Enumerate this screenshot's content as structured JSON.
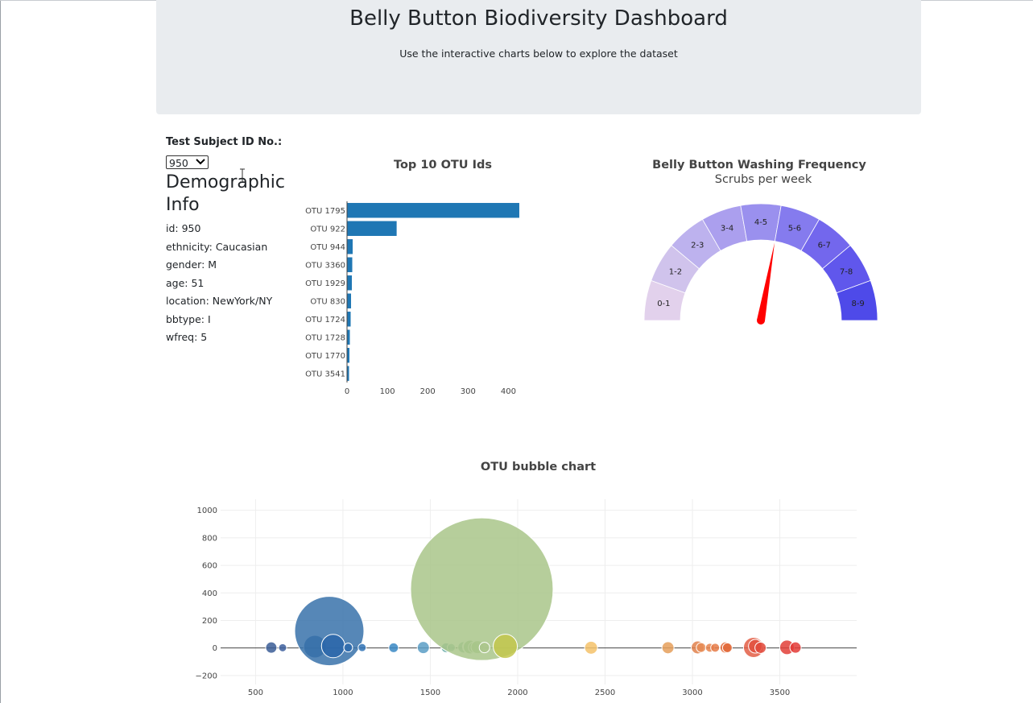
{
  "header": {
    "title": "Belly Button Biodiversity Dashboard",
    "subtitle": "Use the interactive charts below to explore the dataset"
  },
  "selector": {
    "label": "Test Subject ID No.:",
    "selected": "950"
  },
  "demographics": {
    "title": "Demographic Info",
    "items": [
      "id: 950",
      "ethnicity: Caucasian",
      "gender: M",
      "age: 51",
      "location: NewYork/NY",
      "bbtype: I",
      "wfreq: 5"
    ]
  },
  "colors": {
    "bar": "#1f77b4",
    "needle": "#ff0000",
    "jumbotron": "#e9ecef"
  },
  "chart_data": [
    {
      "type": "bar",
      "orientation": "horizontal",
      "title": "Top 10 OTU Ids",
      "categories": [
        "OTU 1795",
        "OTU 922",
        "OTU 944",
        "OTU 3360",
        "OTU 1929",
        "OTU 830",
        "OTU 1724",
        "OTU 1728",
        "OTU 1770",
        "OTU 3541"
      ],
      "values": [
        427,
        123,
        14,
        13,
        12,
        10,
        9,
        7,
        6,
        5
      ],
      "xticks": [
        0,
        100,
        200,
        300,
        400
      ],
      "xlim": [
        0,
        449
      ]
    },
    {
      "type": "gauge",
      "title": "Belly Button Washing Frequency",
      "subtitle": "Scrubs per week",
      "segments": [
        "0-1",
        "1-2",
        "2-3",
        "3-4",
        "4-5",
        "5-6",
        "6-7",
        "7-8",
        "8-9"
      ],
      "segment_colors": [
        "#e2d1ec",
        "#d0c3ec",
        "#bdb2ee",
        "#ab9fee",
        "#9a90ee",
        "#857bee",
        "#7367ed",
        "#6057ec",
        "#4e4ae9"
      ],
      "value": 5,
      "range": [
        0,
        9
      ]
    },
    {
      "type": "scatter",
      "title": "OTU bubble chart",
      "xticks": [
        500,
        1000,
        1500,
        2000,
        2500,
        3000,
        3500
      ],
      "yticks": [
        -200,
        0,
        200,
        400,
        600,
        800,
        1000
      ],
      "xlim": [
        300,
        3940
      ],
      "ylim": [
        -265,
        1080
      ],
      "points": [
        {
          "x": 590,
          "y": 3,
          "size": 14,
          "color": "#3b5d97"
        },
        {
          "x": 655,
          "y": 2,
          "size": 10,
          "color": "#3d5f9d"
        },
        {
          "x": 840,
          "y": 10,
          "size": 28,
          "color": "#2b61a2"
        },
        {
          "x": 922,
          "y": 123,
          "size": 86,
          "color": "#3872aa"
        },
        {
          "x": 944,
          "y": 14,
          "size": 29,
          "color": "#2a66aa"
        },
        {
          "x": 1030,
          "y": 3,
          "size": 11,
          "color": "#2d6aad"
        },
        {
          "x": 1110,
          "y": 3,
          "size": 10,
          "color": "#2f72b5"
        },
        {
          "x": 1290,
          "y": 2,
          "size": 12,
          "color": "#3a88c4"
        },
        {
          "x": 1460,
          "y": 3,
          "size": 15,
          "color": "#5a9ec6"
        },
        {
          "x": 1590,
          "y": 2,
          "size": 12,
          "color": "#63a8a5"
        },
        {
          "x": 1620,
          "y": 3,
          "size": 10,
          "color": "#77b5a3"
        },
        {
          "x": 1690,
          "y": 5,
          "size": 14,
          "color": "#84b89a"
        },
        {
          "x": 1724,
          "y": 9,
          "size": 17,
          "color": "#8ebd95"
        },
        {
          "x": 1728,
          "y": 7,
          "size": 17,
          "color": "#97c092"
        },
        {
          "x": 1750,
          "y": 4,
          "size": 14,
          "color": "#98c195"
        },
        {
          "x": 1770,
          "y": 6,
          "size": 16,
          "color": "#a3c68f"
        },
        {
          "x": 1795,
          "y": 427,
          "size": 177,
          "color": "#a9c68a"
        },
        {
          "x": 1810,
          "y": 3,
          "size": 13,
          "color": "#acc68c"
        },
        {
          "x": 1929,
          "y": 12,
          "size": 30,
          "color": "#c3c74c"
        },
        {
          "x": 2420,
          "y": 2,
          "size": 16,
          "color": "#f4c26a"
        },
        {
          "x": 2860,
          "y": 2,
          "size": 15,
          "color": "#e59f5a"
        },
        {
          "x": 3030,
          "y": 4,
          "size": 16,
          "color": "#e0814c"
        },
        {
          "x": 3050,
          "y": 3,
          "size": 12,
          "color": "#e88c56"
        },
        {
          "x": 3100,
          "y": 2,
          "size": 11,
          "color": "#e8844d"
        },
        {
          "x": 3130,
          "y": 2,
          "size": 11,
          "color": "#e67b48"
        },
        {
          "x": 3190,
          "y": 3,
          "size": 14,
          "color": "#e46c3b"
        },
        {
          "x": 3200,
          "y": 2,
          "size": 12,
          "color": "#e26a3a"
        },
        {
          "x": 3350,
          "y": 4,
          "size": 25,
          "color": "#e35e45"
        },
        {
          "x": 3360,
          "y": 13,
          "size": 17,
          "color": "#e25140"
        },
        {
          "x": 3390,
          "y": 2,
          "size": 14,
          "color": "#e24a3c"
        },
        {
          "x": 3541,
          "y": 5,
          "size": 18,
          "color": "#e23e37"
        },
        {
          "x": 3590,
          "y": 3,
          "size": 14,
          "color": "#e33a36"
        }
      ]
    }
  ]
}
